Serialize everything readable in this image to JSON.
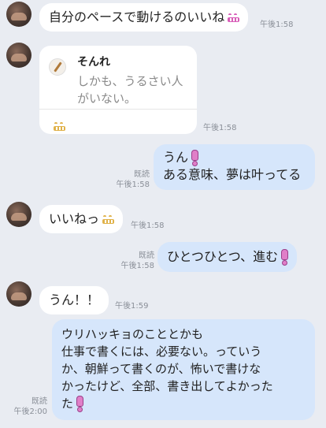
{
  "messages": [
    {
      "id": "m1",
      "side": "left",
      "text": "自分のペースで動けるのいいね",
      "time": "午後1:58"
    },
    {
      "id": "m2",
      "side": "left",
      "quote_author": "そんれ",
      "quote_text_1": "しかも、うるさい人",
      "quote_text_2": "がいない。",
      "time": "午後1:58"
    },
    {
      "id": "m3",
      "side": "right",
      "line1": "うん",
      "line2": "ある意味、夢は叶ってる",
      "read": "既読",
      "time": "午後1:58"
    },
    {
      "id": "m4",
      "side": "left",
      "text": "いいねっ",
      "time": "午後1:58"
    },
    {
      "id": "m5",
      "side": "right",
      "text": "ひとつひとつ、進む",
      "read": "既読",
      "time": "午後1:58"
    },
    {
      "id": "m6",
      "side": "left",
      "text": "うん！！",
      "time": "午後1:59"
    },
    {
      "id": "m7",
      "side": "right",
      "lines": [
        "ウリハッキョのこととかも",
        "仕事で書くには、必要ない。っていう",
        "か、朝鮮って書くのが、怖いで書けな",
        "かったけど、全部、書き出してよかった",
        "た"
      ],
      "read": "既読",
      "time": "午後2:00"
    }
  ],
  "icons": {
    "avatar": "avatar-photo",
    "exclamation": "pink-exclamation-emoji",
    "grin": "grinning-face-emoji",
    "quote_user": "pencil-avatar-icon"
  },
  "colors": {
    "background": "#e9ecf2",
    "incoming_bubble": "#ffffff",
    "outgoing_bubble": "#d6e6fb"
  }
}
